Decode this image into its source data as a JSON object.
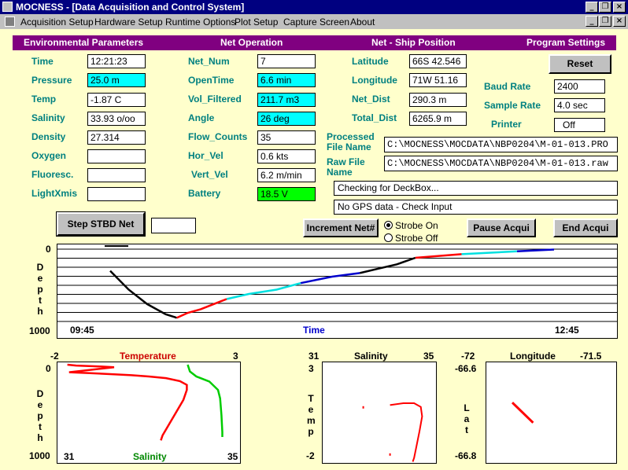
{
  "window": {
    "title": "MOCNESS - [Data Acquisition and Control System]"
  },
  "menu": [
    "Acquisition Setup",
    "Hardware Setup",
    "Runtime Options",
    "Plot Setup",
    "Capture Screen",
    "About"
  ],
  "sections": {
    "env": "Environmental Parameters",
    "net": "Net Operation",
    "pos": "Net - Ship Position",
    "prog": "Program Settings"
  },
  "env": {
    "time": {
      "label": "Time",
      "value": "12:21:23"
    },
    "pressure": {
      "label": "Pressure",
      "value": "25.0 m"
    },
    "temp": {
      "label": "Temp",
      "value": "-1.87 C"
    },
    "salinity": {
      "label": "Salinity",
      "value": "33.93 o/oo"
    },
    "density": {
      "label": "Density",
      "value": "27.314"
    },
    "oxygen": {
      "label": "Oxygen",
      "value": ""
    },
    "fluoresc": {
      "label": "Fluoresc.",
      "value": ""
    },
    "lightxmis": {
      "label": "LightXmis",
      "value": ""
    }
  },
  "net": {
    "net_num": {
      "label": "Net_Num",
      "value": "7"
    },
    "opentime": {
      "label": "OpenTime",
      "value": "6.6 min"
    },
    "vol_filtered": {
      "label": "Vol_Filtered",
      "value": "211.7 m3"
    },
    "angle": {
      "label": "Angle",
      "value": "26 deg"
    },
    "flow_counts": {
      "label": "Flow_Counts",
      "value": "35"
    },
    "hor_vel": {
      "label": "Hor_Vel",
      "value": "0.6 kts"
    },
    "vert_vel": {
      "label": "Vert_Vel",
      "value": "6.2 m/min"
    },
    "battery": {
      "label": "Battery",
      "value": "18.5 V"
    }
  },
  "pos": {
    "latitude": {
      "label": "Latitude",
      "value": "66S 42.546"
    },
    "longitude": {
      "label": "Longitude",
      "value": "71W 51.16"
    },
    "net_dist": {
      "label": "Net_Dist",
      "value": "290.3 m"
    },
    "total_dist": {
      "label": "Total_Dist",
      "value": "6265.9 m"
    }
  },
  "prog": {
    "reset": "Reset",
    "baud_rate": {
      "label": "Baud Rate",
      "value": "2400"
    },
    "sample_rate": {
      "label": "Sample Rate",
      "value": "4.0 sec"
    },
    "printer": {
      "label": "Printer",
      "value": "Off"
    }
  },
  "files": {
    "processed_label": "Processed File Name",
    "processed": "C:\\MOCNESS\\MOCDATA\\NBP0204\\M-01-013.PRO",
    "raw_label": "Raw File Name",
    "raw": "C:\\MOCNESS\\MOCDATA\\NBP0204\\M-01-013.raw"
  },
  "status": {
    "line1": "Checking for DeckBox...",
    "line2": "No GPS data - Check Input"
  },
  "buttons": {
    "step": "Step STBD Net",
    "increment": "Increment Net#",
    "pause": "Pause Acqui",
    "end": "End Acqui"
  },
  "strobe": {
    "on": "Strobe On",
    "off": "Strobe Off",
    "selected": "on"
  },
  "colors": {
    "highlight": "#00ffff",
    "battery": "#00ff00",
    "header": "#800080",
    "label": "#008080",
    "background": "#ffffcc"
  },
  "chart_data": [
    {
      "type": "line",
      "title": "",
      "ylabel": "Depth",
      "xlabel": "Time",
      "x_start": "09:45",
      "x_end": "12:45",
      "ylim": [
        0,
        1000
      ],
      "y_top_label": "0",
      "y_bottom_label": "1000",
      "grid": true,
      "segments": [
        {
          "color": "#000000",
          "points": [
            [
              0.2,
              300
            ],
            [
              0.3,
              560
            ],
            [
              0.4,
              760
            ],
            [
              0.5,
              900
            ],
            [
              0.55,
              940
            ],
            [
              0.56,
              950
            ]
          ]
        },
        {
          "color": "#ff0000",
          "points": [
            [
              0.56,
              950
            ],
            [
              0.62,
              880
            ],
            [
              0.69,
              830
            ],
            [
              0.75,
              770
            ],
            [
              0.8,
              720
            ],
            [
              0.83,
              690
            ]
          ]
        },
        {
          "color": "#00e0e0",
          "points": [
            [
              0.83,
              690
            ],
            [
              0.95,
              620
            ],
            [
              1.1,
              560
            ],
            [
              1.23,
              470
            ]
          ]
        },
        {
          "color": "#0000cc",
          "points": [
            [
              1.23,
              470
            ],
            [
              1.4,
              380
            ],
            [
              1.55,
              330
            ]
          ]
        },
        {
          "color": "#000000",
          "points": [
            [
              1.55,
              330
            ],
            [
              1.65,
              270
            ],
            [
              1.75,
              210
            ],
            [
              1.85,
              120
            ]
          ]
        },
        {
          "color": "#ff0000",
          "points": [
            [
              1.85,
              120
            ],
            [
              2.1,
              70
            ]
          ]
        },
        {
          "color": "#00e0e0",
          "points": [
            [
              2.1,
              70
            ],
            [
              2.4,
              30
            ]
          ]
        },
        {
          "color": "#0000cc",
          "points": [
            [
              2.4,
              30
            ],
            [
              2.6,
              5
            ]
          ]
        }
      ]
    },
    {
      "type": "scatter",
      "title": "Temperature",
      "xlabel": "Salinity",
      "ylabel": "Depth",
      "temp_range": [
        -2,
        3
      ],
      "sal_range": [
        31,
        35
      ],
      "ylim": [
        0,
        1000
      ],
      "y_top_label": "0",
      "y_bottom_label": "1000",
      "series": [
        {
          "name": "Temperature",
          "axis": "temperature",
          "color": "#ff0000",
          "points": [
            [
              -1.85,
              0
            ],
            [
              -1.6,
              10
            ],
            [
              -1.0,
              20
            ],
            [
              -0.5,
              30
            ],
            [
              -1.8,
              90
            ],
            [
              -1.2,
              100
            ],
            [
              -0.5,
              115
            ],
            [
              0.0,
              125
            ],
            [
              0.5,
              140
            ],
            [
              1.0,
              160
            ],
            [
              1.4,
              195
            ],
            [
              1.6,
              240
            ],
            [
              1.6,
              300
            ],
            [
              1.5,
              420
            ],
            [
              1.3,
              560
            ],
            [
              1.1,
              700
            ],
            [
              0.9,
              840
            ],
            [
              0.85,
              900
            ]
          ]
        },
        {
          "name": "Salinity",
          "axis": "salinity",
          "color": "#00cc00",
          "points": [
            [
              33.9,
              0
            ],
            [
              33.95,
              80
            ],
            [
              34.1,
              140
            ],
            [
              34.4,
              200
            ],
            [
              34.6,
              300
            ],
            [
              34.65,
              400
            ],
            [
              34.68,
              600
            ],
            [
              34.7,
              800
            ],
            [
              34.7,
              860
            ]
          ]
        }
      ]
    },
    {
      "type": "scatter",
      "title": "Salinity",
      "xlabel": "",
      "ylabel": "Temp",
      "xlim": [
        31,
        35
      ],
      "ylim": [
        -2,
        3
      ],
      "series": [
        {
          "name": "",
          "color": "#ff0000",
          "points": [
            [
              32.4,
              0.8
            ],
            [
              33.4,
              0.9
            ],
            [
              33.9,
              1.0
            ],
            [
              34.3,
              1.0
            ],
            [
              34.55,
              0.8
            ],
            [
              34.6,
              0.3
            ],
            [
              34.5,
              -0.5
            ],
            [
              34.4,
              -1.2
            ],
            [
              34.3,
              -1.9
            ],
            [
              34.25,
              -2.1
            ],
            [
              33.4,
              -1.7
            ]
          ]
        }
      ]
    },
    {
      "type": "scatter",
      "title": "Longitude",
      "xlabel": "",
      "ylabel": "Lat",
      "xlim": [
        -72,
        -71.5
      ],
      "ylim": [
        -66.8,
        -66.6
      ],
      "series": [
        {
          "name": "",
          "color": "#ff0000",
          "points": [
            [
              -71.9,
              -66.68
            ],
            [
              -71.87,
              -66.695
            ],
            [
              -71.84,
              -66.71
            ],
            [
              -71.82,
              -66.72
            ]
          ]
        }
      ]
    }
  ]
}
